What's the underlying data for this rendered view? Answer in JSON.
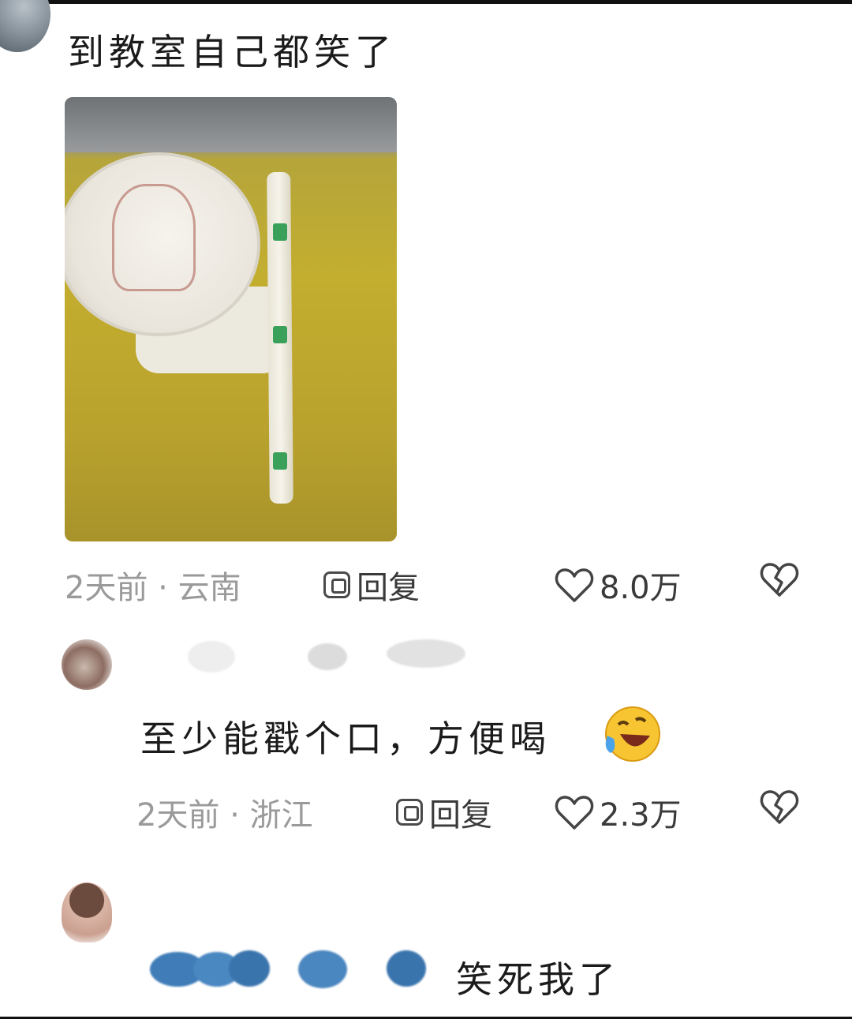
{
  "comments": [
    {
      "text": "到教室自己都笑了",
      "time_location": "2天前 · 云南",
      "reply_label": "回复",
      "likes": "8.0万"
    },
    {
      "text": "至少能戳个口，方便喝",
      "emoji": "rolling-on-floor-laughing",
      "time_location": "2天前 · 浙江",
      "reply_label": "回复",
      "likes": "2.3万"
    },
    {
      "text": "笑死我了"
    }
  ],
  "colors": {
    "meta_gray": "#9a9a9a",
    "icon_dark": "#3a3a3a",
    "redaction_blue": "#3f7cb8"
  }
}
